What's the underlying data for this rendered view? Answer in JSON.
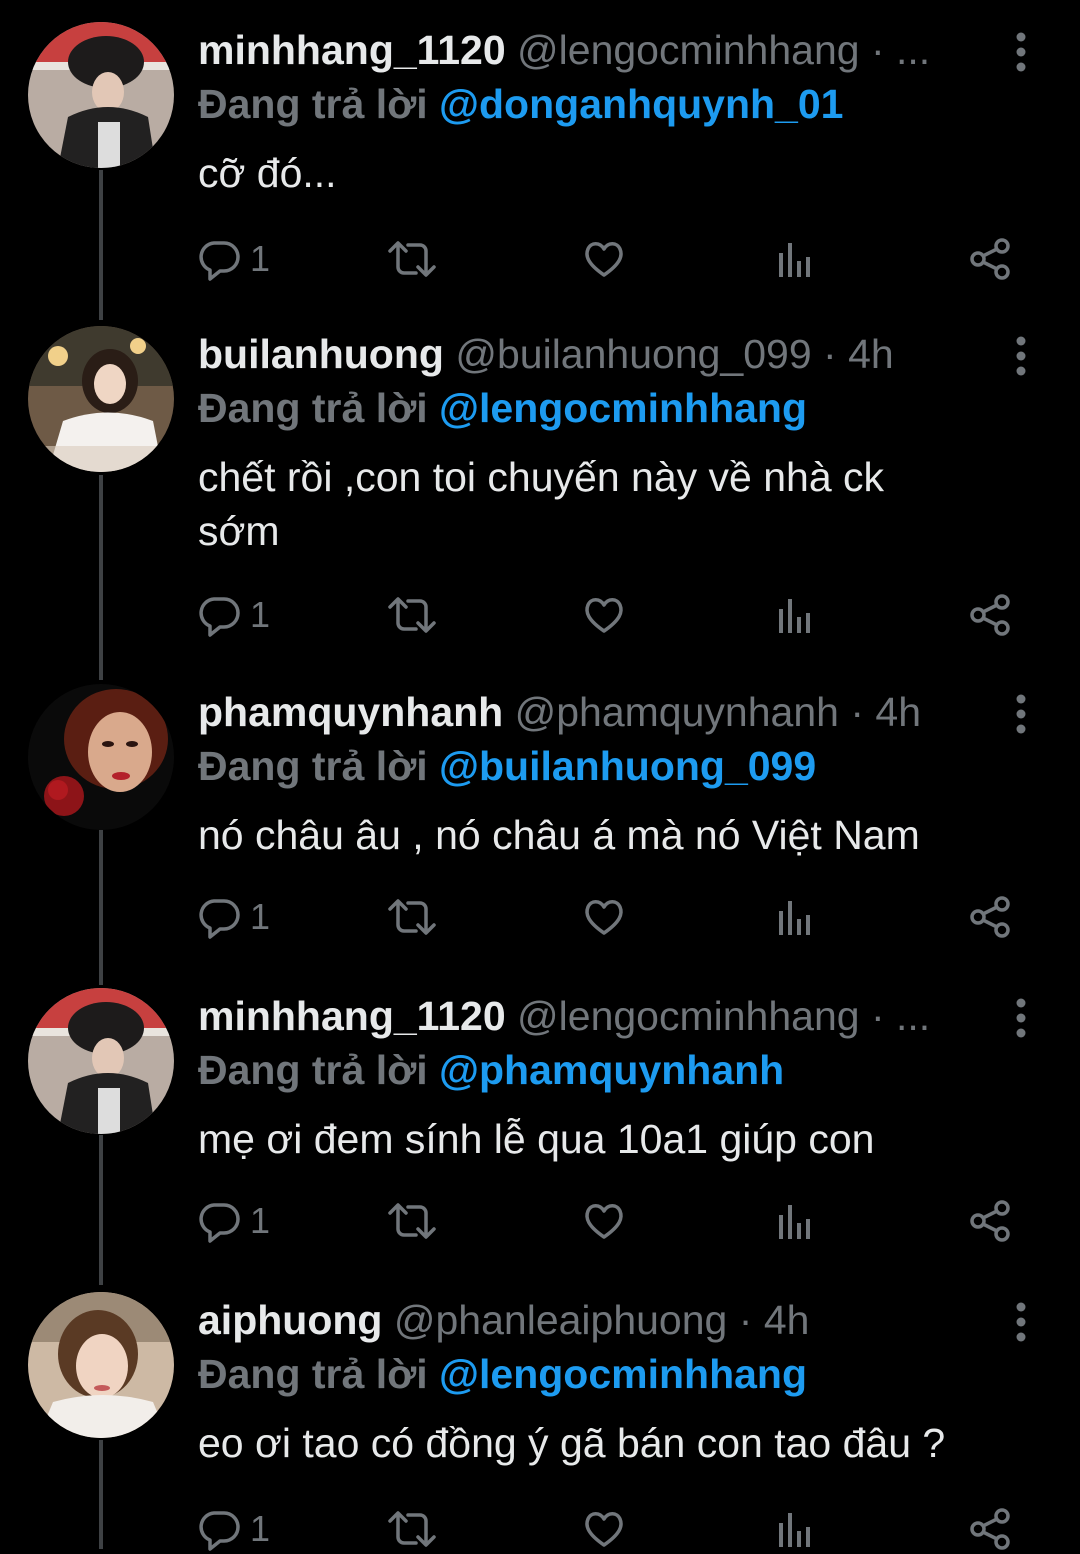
{
  "tweets": [
    {
      "display_name": "minhhang_1120",
      "handle": "@lengocminhhang",
      "separator": "·",
      "time": "...",
      "reply_label": "Đang trả lời",
      "reply_to": "@donganhquynh_01",
      "text": "cỡ đó...",
      "reply_count": "1"
    },
    {
      "display_name": "builanhuong",
      "handle": "@builanhuong_099",
      "separator": "·",
      "time": "4h",
      "reply_label": "Đang trả lời",
      "reply_to": "@lengocminhhang",
      "text": "chết rồi ,con toi chuyến này về nhà ck sớm",
      "reply_count": "1"
    },
    {
      "display_name": "phamquynhanh",
      "handle": "@phamquynhanh",
      "separator": "·",
      "time": "4h",
      "reply_label": "Đang trả lời",
      "reply_to": "@builanhuong_099",
      "text": "nó châu âu , nó châu á mà nó Việt Nam",
      "reply_count": "1"
    },
    {
      "display_name": "minhhang_1120",
      "handle": "@lengocminhhang",
      "separator": "·",
      "time": "...",
      "reply_label": "Đang trả lời",
      "reply_to": "@phamquynhanh",
      "text": "mẹ ơi đem sính lễ qua 10a1 giúp con",
      "reply_count": "1"
    },
    {
      "display_name": "aiphuong",
      "handle": "@phanleaiphuong",
      "separator": "·",
      "time": "4h",
      "reply_label": "Đang trả lời",
      "reply_to": "@lengocminhhang",
      "text": "eo ơi tao có đồng ý gã bán con tao đâu ?",
      "reply_count": "1"
    }
  ],
  "icons": {
    "reply": "reply-icon",
    "retweet": "retweet-icon",
    "like": "heart-icon",
    "views": "analytics-icon",
    "share": "share-icon",
    "menu": "more-vertical-icon"
  },
  "colors": {
    "background": "#000000",
    "text": "#e7e9ea",
    "muted": "#71767b",
    "mention": "#1d9bf0",
    "thread_line": "#3e4144"
  }
}
